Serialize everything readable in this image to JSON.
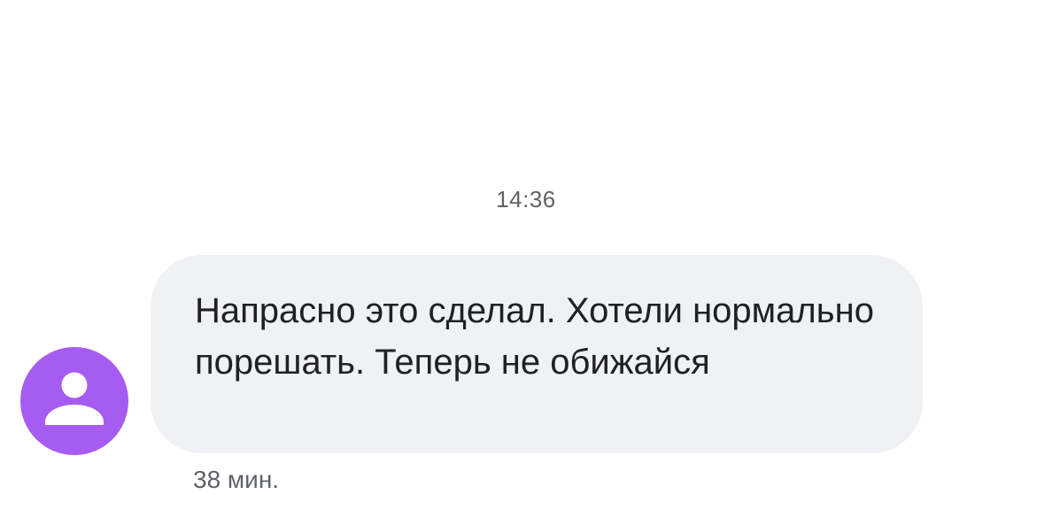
{
  "conversation": {
    "timestamp": "14:36",
    "messages": [
      {
        "text": "Напрасно это сделал. Хотели нормально порешать. Теперь не обижайся",
        "age": "38 мин."
      }
    ]
  },
  "colors": {
    "avatar": "#a65cf0",
    "bubble": "#f0f1f4",
    "text": "#202124",
    "secondary_text": "#5f6368"
  },
  "icons": {
    "avatar": "person-icon"
  }
}
